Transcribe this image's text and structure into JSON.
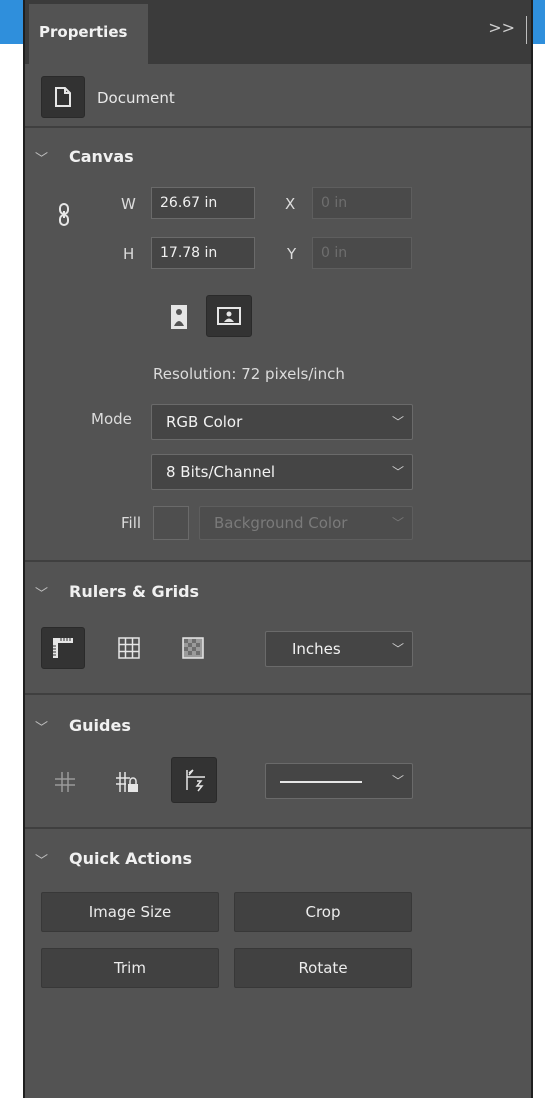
{
  "panel": {
    "tab_label": "Properties",
    "collapse_label": ">>"
  },
  "document": {
    "label": "Document"
  },
  "canvas": {
    "title": "Canvas",
    "w_label": "W",
    "w_value": "26.67 in",
    "h_label": "H",
    "h_value": "17.78 in",
    "x_label": "X",
    "x_value": "0 in",
    "y_label": "Y",
    "y_value": "0 in",
    "resolution": "Resolution: 72 pixels/inch",
    "mode_label": "Mode",
    "mode_value": "RGB Color",
    "bits_value": "8 Bits/Channel",
    "fill_label": "Fill",
    "fill_value": "Background Color"
  },
  "rulers": {
    "title": "Rulers & Grids",
    "units_value": "Inches"
  },
  "guides": {
    "title": "Guides"
  },
  "quick_actions": {
    "title": "Quick Actions",
    "buttons": [
      "Image Size",
      "Crop",
      "Trim",
      "Rotate"
    ]
  },
  "colors": {
    "panel_bg": "#535353",
    "tab_bar": "#3b3b3b",
    "accent": "#2f8fdc"
  }
}
